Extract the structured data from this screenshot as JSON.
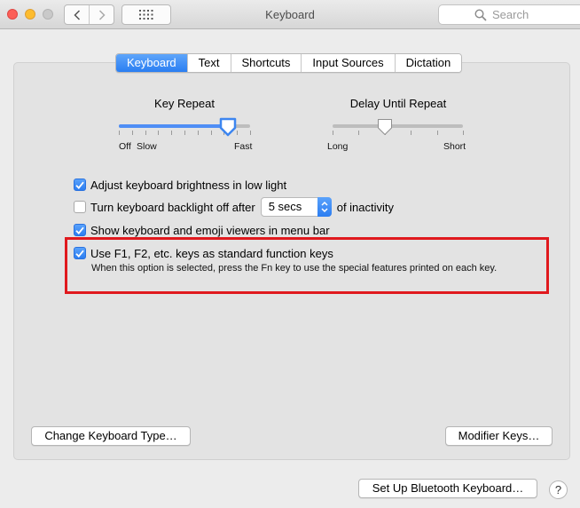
{
  "window": {
    "title": "Keyboard"
  },
  "toolbar": {
    "back_icon": "chevron-left-icon",
    "forward_icon": "chevron-right-icon",
    "grid_icon": "grid-icon",
    "search_placeholder": "Search"
  },
  "tabs": [
    {
      "label": "Keyboard",
      "active": true
    },
    {
      "label": "Text",
      "active": false
    },
    {
      "label": "Shortcuts",
      "active": false
    },
    {
      "label": "Input Sources",
      "active": false
    },
    {
      "label": "Dictation",
      "active": false
    }
  ],
  "key_repeat": {
    "title": "Key Repeat",
    "label_off": "Off",
    "label_slow": "Slow",
    "label_fast": "Fast",
    "value_fraction": 0.83
  },
  "delay_until_repeat": {
    "title": "Delay Until Repeat",
    "label_long": "Long",
    "label_short": "Short",
    "value_fraction": 0.4
  },
  "options": {
    "brightness": {
      "label": "Adjust keyboard brightness in low light",
      "checked": true
    },
    "backlight": {
      "label": "Turn keyboard backlight off after",
      "checked": false,
      "select_value": "5 secs",
      "suffix": "of inactivity"
    },
    "viewers": {
      "label": "Show keyboard and emoji viewers in menu bar",
      "checked": true
    },
    "fn_keys": {
      "label": "Use F1, F2, etc. keys as standard function keys",
      "checked": true,
      "help": "When this option is selected, press the Fn key to use the special features printed on each key."
    }
  },
  "buttons": {
    "change_type": "Change Keyboard Type…",
    "modifier": "Modifier Keys…",
    "bluetooth": "Set Up Bluetooth Keyboard…",
    "help": "?"
  },
  "colors": {
    "accent": "#2b7df1",
    "highlight": "#e0191e"
  }
}
